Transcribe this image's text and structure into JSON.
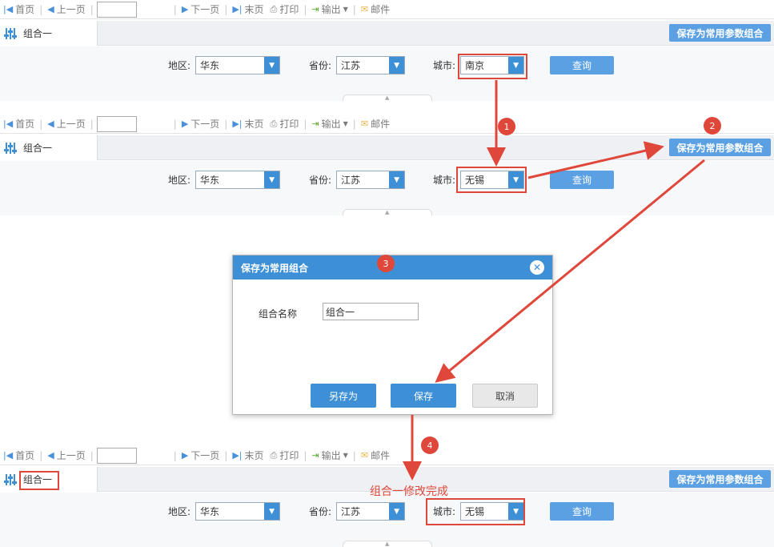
{
  "toolbar": {
    "first": "首页",
    "prev": "上一页",
    "next": "下一页",
    "last": "末页",
    "print": "打印",
    "export": "输出",
    "mail": "邮件"
  },
  "tab_label": "组合一",
  "save_common_label": "保存为常用参数组合",
  "params": {
    "region_label": "地区:",
    "region_value": "华东",
    "province_label": "省份:",
    "province_value": "江苏",
    "city_label": "城市:",
    "query_label": "查询"
  },
  "panels": [
    {
      "city_value": "南京"
    },
    {
      "city_value": "无锡"
    },
    {
      "city_value": "无锡"
    }
  ],
  "dialog": {
    "title": "保存为常用组合",
    "name_label": "组合名称",
    "name_value": "组合一",
    "save_as": "另存为",
    "save": "保存",
    "cancel": "取消"
  },
  "badges": [
    "1",
    "2",
    "3",
    "4"
  ],
  "note": "组合一修改完成",
  "colors": {
    "accent": "#3d8fd6",
    "button": "#5aa0e3",
    "annotation_red": "#e0473b"
  },
  "icons": {
    "first": "first-page-icon",
    "prev": "prev-page-icon",
    "next": "next-page-icon",
    "last": "last-page-icon",
    "print": "printer-icon",
    "export": "export-icon",
    "mail": "mail-icon",
    "tab": "sliders-icon",
    "close": "close-icon"
  }
}
